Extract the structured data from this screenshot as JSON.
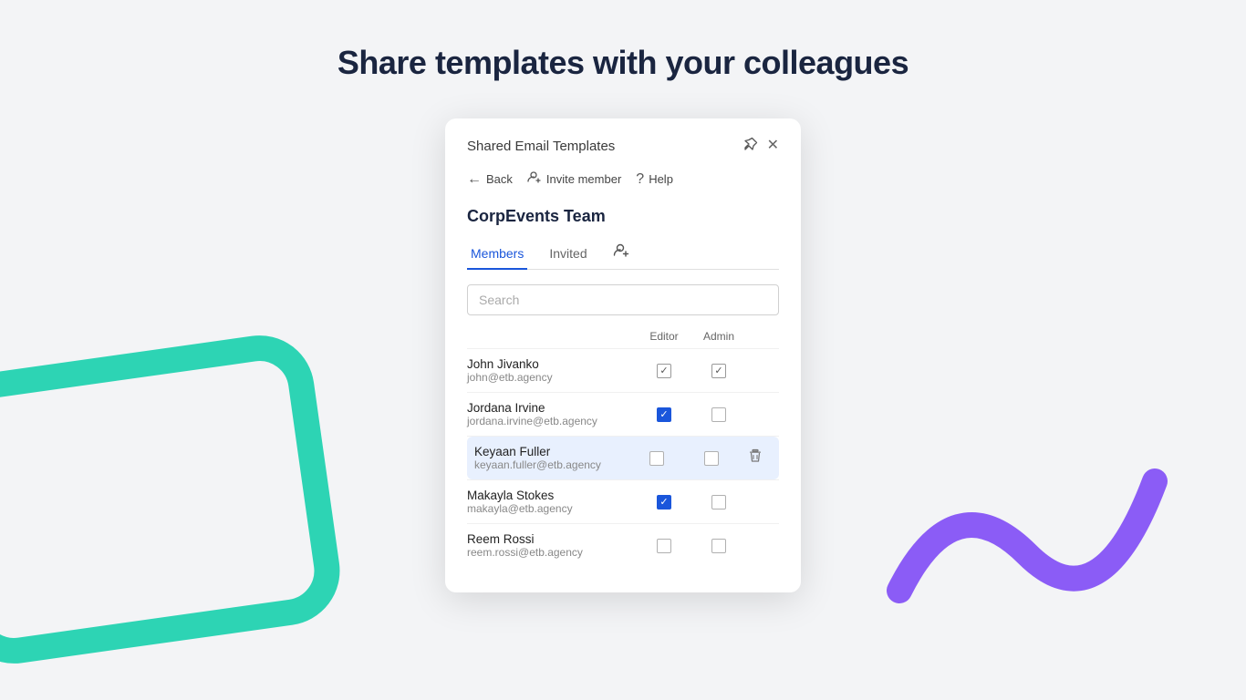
{
  "page": {
    "heading": "Share templates with your colleagues",
    "background_color": "#f3f4f6"
  },
  "dialog": {
    "title": "Shared Email Templates",
    "pin_icon": "📌",
    "close_icon": "✕",
    "nav": {
      "back_label": "Back",
      "invite_label": "Invite member",
      "help_label": "Help"
    },
    "team_name": "CorpEvents Team",
    "tabs": [
      {
        "id": "members",
        "label": "Members",
        "active": true
      },
      {
        "id": "invited",
        "label": "Invited",
        "active": false
      }
    ],
    "search_placeholder": "Search",
    "table": {
      "col_editor": "Editor",
      "col_admin": "Admin",
      "members": [
        {
          "name": "John Jivanko",
          "email": "john@etb.agency",
          "editor": "gray-checked",
          "admin": "gray-checked",
          "highlighted": false,
          "show_delete": false
        },
        {
          "name": "Jordana Irvine",
          "email": "jordana.irvine@etb.agency",
          "editor": "blue-checked",
          "admin": "unchecked",
          "highlighted": false,
          "show_delete": false
        },
        {
          "name": "Keyaan Fuller",
          "email": "keyaan.fuller@etb.agency",
          "editor": "unchecked",
          "admin": "unchecked",
          "highlighted": true,
          "show_delete": true
        },
        {
          "name": "Makayla Stokes",
          "email": "makayla@etb.agency",
          "editor": "blue-checked",
          "admin": "unchecked",
          "highlighted": false,
          "show_delete": false
        },
        {
          "name": "Reem Rossi",
          "email": "reem.rossi@etb.agency",
          "editor": "unchecked",
          "admin": "unchecked",
          "highlighted": false,
          "show_delete": false
        }
      ]
    }
  }
}
